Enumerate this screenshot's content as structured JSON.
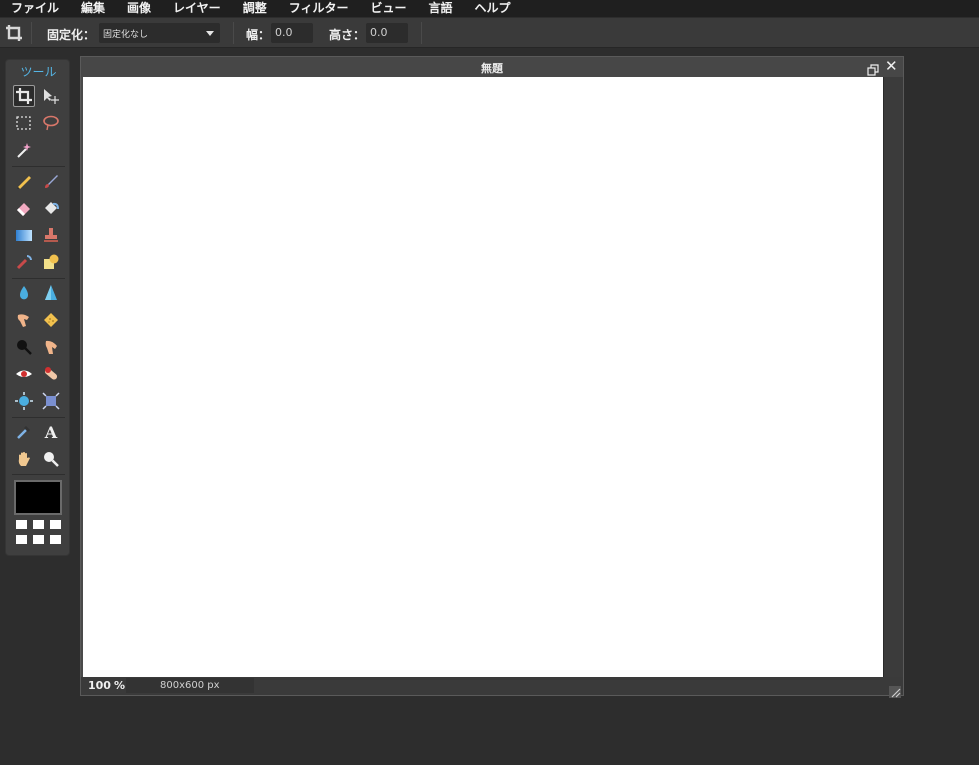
{
  "menu": [
    "ファイル",
    "編集",
    "画像",
    "レイヤー",
    "調整",
    "フィルター",
    "ビュー",
    "言語",
    "ヘルプ"
  ],
  "options": {
    "fixed_label": "固定化：",
    "fixed_value": "固定化なし",
    "width_label": "幅：",
    "width_value": "0.0",
    "height_label": "高さ：",
    "height_value": "0.0"
  },
  "tools": {
    "title": "ツール",
    "items": [
      "crop-icon",
      "move-icon",
      "marquee-icon",
      "lasso-icon",
      "magic-wand-icon",
      "pencil-icon",
      "brush-icon",
      "eraser-icon",
      "bucket-icon",
      "gradient-icon",
      "stamp-icon",
      "color-replace-icon",
      "shape-icon",
      "blur-icon",
      "sharpen-icon",
      "smudge-icon",
      "sponge-icon",
      "burn-icon",
      "dodge-icon",
      "red-eye-icon",
      "spot-heal-icon",
      "bloat-icon",
      "pinch-icon",
      "eyedropper-icon",
      "text-icon",
      "hand-icon",
      "zoom-icon"
    ],
    "foreground_color": "#000000"
  },
  "document": {
    "title": "無題",
    "zoom": "100",
    "zoom_unit": "%",
    "dimensions": "800x600 px"
  }
}
